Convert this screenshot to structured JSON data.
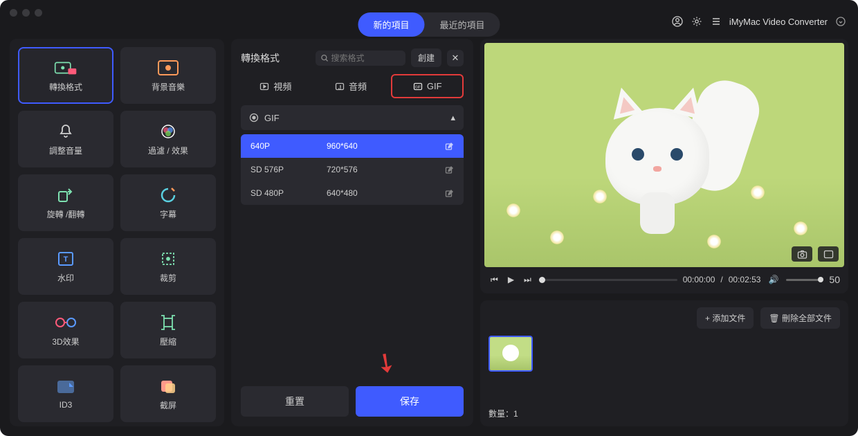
{
  "header": {
    "tabs": {
      "new": "新的項目",
      "recent": "最近的項目"
    },
    "app_name": "iMyMac Video Converter"
  },
  "sidebar": {
    "items": [
      {
        "label": "轉換格式"
      },
      {
        "label": "背景音樂"
      },
      {
        "label": "調整音量"
      },
      {
        "label": "過濾 / 效果"
      },
      {
        "label": "旋轉 /翻轉"
      },
      {
        "label": "字幕"
      },
      {
        "label": "水印"
      },
      {
        "label": "裁剪"
      },
      {
        "label": "3D效果"
      },
      {
        "label": "壓縮"
      },
      {
        "label": "ID3"
      },
      {
        "label": "截屏"
      }
    ]
  },
  "middle": {
    "title": "轉換格式",
    "search_placeholder": "搜索格式",
    "create": "創建",
    "format_tabs": {
      "video": "視頻",
      "audio": "音頻",
      "gif": "GIF"
    },
    "section": "GIF",
    "rows": [
      {
        "name": "640P",
        "res": "960*640"
      },
      {
        "name": "SD 576P",
        "res": "720*576"
      },
      {
        "name": "SD 480P",
        "res": "640*480"
      }
    ],
    "reset": "重置",
    "save": "保存"
  },
  "player": {
    "time_current": "00:00:00",
    "time_total": "00:02:53",
    "volume": "50"
  },
  "filelist": {
    "add": "添加文件",
    "clear": "刪除全部文件",
    "count_label": "數量：",
    "count": "1"
  }
}
